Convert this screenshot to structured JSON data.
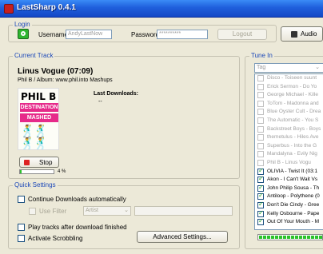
{
  "window": {
    "title": "LastSharp 0.4.1"
  },
  "login": {
    "group_label": "Login",
    "username_label": "Username",
    "username_value": "AndyLastNow",
    "password_label": "Password",
    "password_value": "**********",
    "logout_label": "Logout",
    "audio_label": "Audio"
  },
  "current_track": {
    "group_label": "Current Track",
    "title": "Linus Vogue (07:09)",
    "subtitle": "Phil B / Album: www.phil.into Mashups",
    "last_downloads_label": "Last Downloads:",
    "last_downloads_value": "--",
    "album_art": {
      "line1": "PHIL B",
      "line2": "DESTINATION",
      "line3": "MASHED"
    },
    "stop_label": "Stop",
    "progress_percent": 5,
    "progress_text": "4 %"
  },
  "quick_settings": {
    "group_label": "Quick Settings",
    "continue_downloads": {
      "label": "Continue Downloads automatically",
      "checked": false
    },
    "use_filter": {
      "label": "Use Filter",
      "checked": false,
      "enabled": false,
      "select_value": "Artist"
    },
    "play_tracks": {
      "label": "Play tracks after download finished",
      "checked": false
    },
    "activate_scrobbling": {
      "label": "Activate Scrobbling",
      "checked": false
    },
    "advanced_label": "Advanced Settings..."
  },
  "tune_in": {
    "group_label": "Tune In",
    "select_value": "Tag",
    "tracks": [
      {
        "label": "Disco - Toiseen suunt",
        "checked": false
      },
      {
        "label": "Erick Sermon - Do Yo",
        "checked": false
      },
      {
        "label": "George Michael - Kille",
        "checked": false
      },
      {
        "label": "ToTom - Madonna and",
        "checked": false
      },
      {
        "label": "Blue Oyster Cult - Drea",
        "checked": false
      },
      {
        "label": "The Automatic - You S",
        "checked": false
      },
      {
        "label": "Backstreet Boys - Boys",
        "checked": false
      },
      {
        "label": "themetulus - Hiles Ave",
        "checked": false
      },
      {
        "label": "Superbus - Into the G",
        "checked": false
      },
      {
        "label": "Mandalyna - Evily Nig",
        "checked": false
      },
      {
        "label": "Phil B - Linus Vogu",
        "checked": false
      },
      {
        "label": "OLIVIA - Twist It (03:1",
        "checked": true
      },
      {
        "label": "Akon - I Can't Wait Vs",
        "checked": true
      },
      {
        "label": "John Philip Sousa - Th",
        "checked": true
      },
      {
        "label": "Antiloop - Polythene (0",
        "checked": true
      },
      {
        "label": "Don't Die Cindy - Gree",
        "checked": true
      },
      {
        "label": "Kelly Osbourne - Pape",
        "checked": true
      },
      {
        "label": "Out Of Your Mouth - M",
        "checked": true
      }
    ]
  }
}
